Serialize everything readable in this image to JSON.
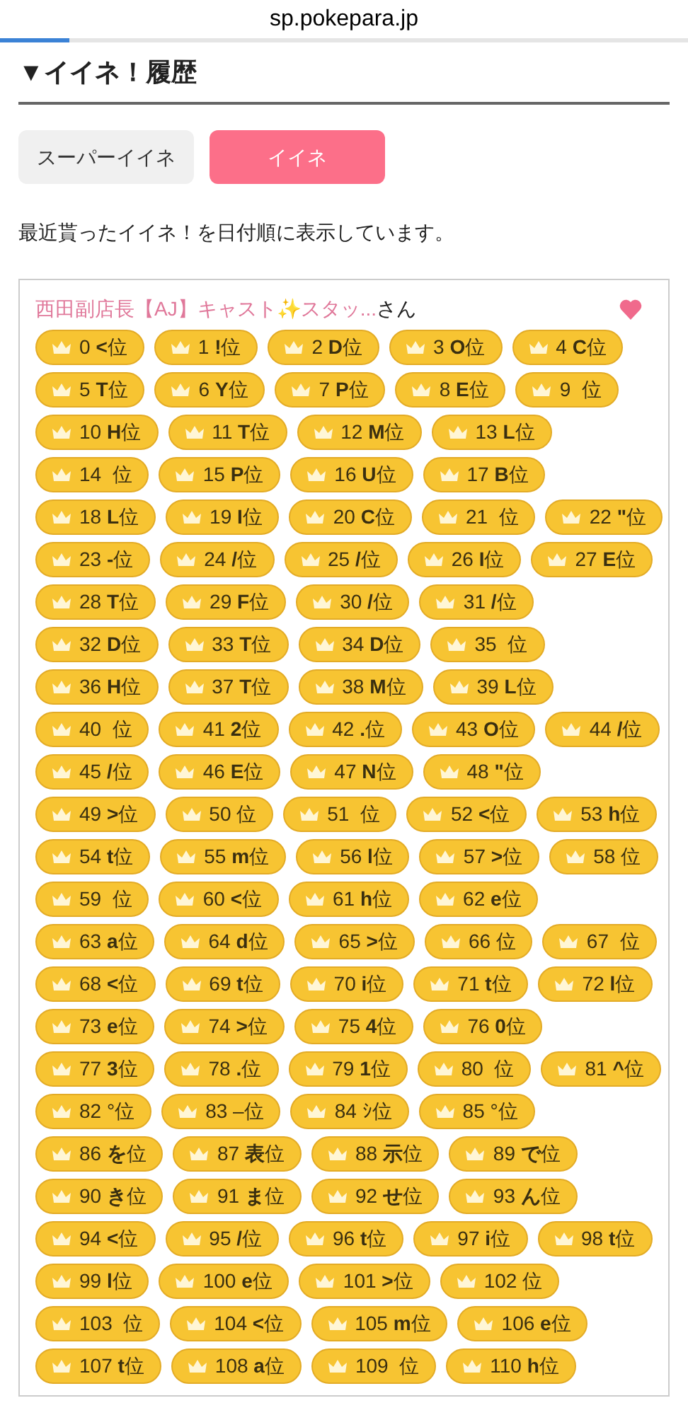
{
  "browser": {
    "url": "sp.pokepara.jp",
    "load_progress": {
      "level": 0.1
    }
  },
  "heading": "▼イイネ！履歴",
  "tabs": [
    {
      "label": "スーパーイイネ",
      "selected": false
    },
    {
      "label": "イイネ",
      "selected": true
    }
  ],
  "description": "最近貰ったイイネ！を日付順に表示しています。",
  "card": {
    "sender": "西田副店長【AJ】キャスト✨スタッ...",
    "suffix": "さん",
    "liked": true,
    "badge_rows": [
      [
        "0 **<**位",
        "1 **!**位",
        "2 **D**位",
        "3 **O**位",
        "4 **C**位"
      ],
      [
        "5 **T**位",
        "6 **Y**位",
        "7 **P**位",
        "8 **E**位",
        "9  位"
      ],
      [
        "10 **H**位",
        "11 **T**位",
        "12 **M**位",
        "13 **L**位"
      ],
      [
        "14  位",
        "15 **P**位",
        "16 **U**位",
        "17 **B**位"
      ],
      [
        "18 **L**位",
        "19 **I**位",
        "20 **C**位",
        "21  位",
        "22 **\"**位"
      ],
      [
        "23 **-**位",
        "24 **/**位",
        "25 **/**位",
        "26 **I**位",
        "27 **E**位"
      ],
      [
        "28 **T**位",
        "29 **F**位",
        "30 **/**位",
        "31 **/**位"
      ],
      [
        "32 **D**位",
        "33 **T**位",
        "34 **D**位",
        "35  位"
      ],
      [
        "36 **H**位",
        "37 **T**位",
        "38 **M**位",
        "39 **L**位"
      ],
      [
        "40  位",
        "41 **2**位",
        "42 **.**位",
        "43 **O**位",
        "44 **/**位"
      ],
      [
        "45 **/**位",
        "46 **E**位",
        "47 **N**位",
        "48 **\"**位"
      ],
      [
        "49 **>**位",
        "50 位",
        "51  位",
        "52 **<**位",
        "53 **h**位"
      ],
      [
        "54 **t**位",
        "55 **m**位",
        "56 **l**位",
        "57 **>**位",
        "58 位"
      ],
      [
        "59  位",
        "60 **<**位",
        "61 **h**位",
        "62 **e**位"
      ],
      [
        "63 **a**位",
        "64 **d**位",
        "65 **>**位",
        "66 位",
        "67  位"
      ],
      [
        "68 **<**位",
        "69 **t**位",
        "70 **i**位",
        "71 **t**位",
        "72 **l**位"
      ],
      [
        "73 **e**位",
        "74 **>**位",
        "75 **4**位",
        "76 **0**位"
      ],
      [
        "77 **3**位",
        "78 **.**位",
        "79 **1**位",
        "80  位",
        "81 **^**位"
      ],
      [
        "82 °位",
        "83 –位",
        "84 ｼ位",
        "85 °位"
      ],
      [
        "86 **を**位",
        "87 **表**位",
        "88 **示**位",
        "89 **で**位"
      ],
      [
        "90 **き**位",
        "91 **ま**位",
        "92 **せ**位",
        "93 **ん**位"
      ],
      [
        "94 **<**位",
        "95 **/**位",
        "96 **t**位",
        "97 **i**位",
        "98 **t**位"
      ],
      [
        "99 **l**位",
        "100 **e**位",
        "101 **>**位",
        "102 位"
      ],
      [
        "103  位",
        "104 **<**位",
        "105 **m**位",
        "106 **e**位"
      ],
      [
        "107 **t**位",
        "108 **a**位",
        "109  位",
        "110 **h**位"
      ]
    ]
  }
}
